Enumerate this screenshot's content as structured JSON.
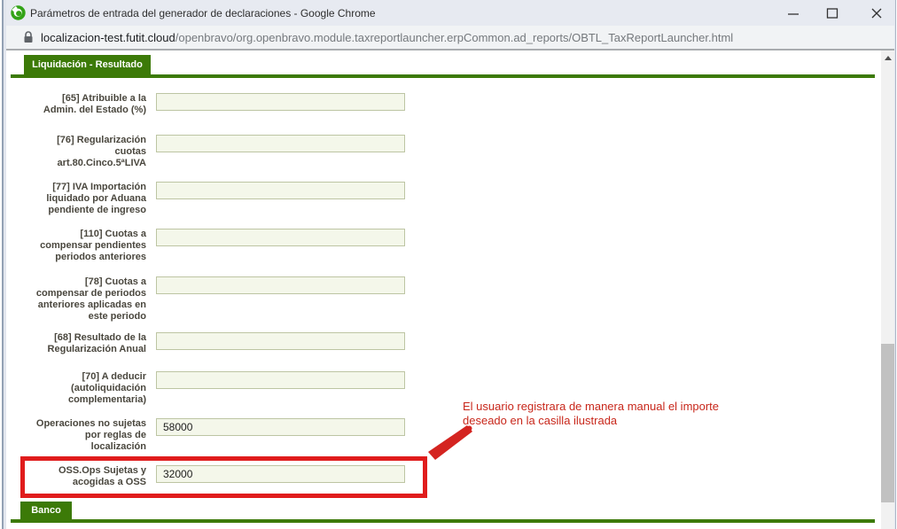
{
  "window": {
    "title": "Parámetros de entrada del generador de declaraciones - Google Chrome",
    "icons": {
      "app": "openbravo-logo-icon",
      "controls": [
        "minimize-icon",
        "maximize-icon",
        "close-icon"
      ]
    }
  },
  "urlbar": {
    "lock_icon": "lock-icon",
    "domain": "localizacion-test.futit.cloud",
    "path": "/openbravo/org.openbravo.module.taxreportlauncher.erpCommon.ad_reports/OBTL_TaxReportLauncher.html"
  },
  "section_tabs": {
    "top": "Liquidación - Resultado",
    "bottom": "Banco"
  },
  "form": {
    "fields": [
      {
        "label": "[65] Atribuible a la\nAdmin. del Estado (%)",
        "value": ""
      },
      {
        "label": "[76] Regularización\ncuotas\nart.80.Cinco.5ªLIVA",
        "value": ""
      },
      {
        "label": "[77] IVA Importación\nliquidado por Aduana\npendiente de ingreso",
        "value": ""
      },
      {
        "label": "[110] Cuotas a\ncompensar pendientes\nperiodos anteriores",
        "value": ""
      },
      {
        "label": "[78] Cuotas a\ncompensar de periodos\nanteriores aplicadas en\neste periodo",
        "value": ""
      },
      {
        "label": "[68] Resultado de la\nRegularización Anual",
        "value": ""
      },
      {
        "label": "[70] A deducir\n(autoliquidación\ncomplementaria)",
        "value": ""
      },
      {
        "label": "Operaciones no sujetas\npor reglas de\nlocalización",
        "value": "58000"
      },
      {
        "label": "OSS.Ops Sujetas y\nacogidas a OSS",
        "value": "32000",
        "highlighted": true
      }
    ]
  },
  "annotation": {
    "text": "El usuario registrara de manera manual el importe\ndeseado en la casilla ilustrada",
    "box_icon": "red-highlight-box",
    "arrow_icon": "red-arrow-icon"
  },
  "scrollbar": {
    "up_icon": "scroll-up-arrow-icon"
  },
  "colors": {
    "green": "#3c7a08",
    "label_text": "#4a473e",
    "field_bg": "#f4f7ea",
    "field_border": "#bdc5a3",
    "red": "#e01c1c",
    "annotation_text": "#c8271b"
  }
}
